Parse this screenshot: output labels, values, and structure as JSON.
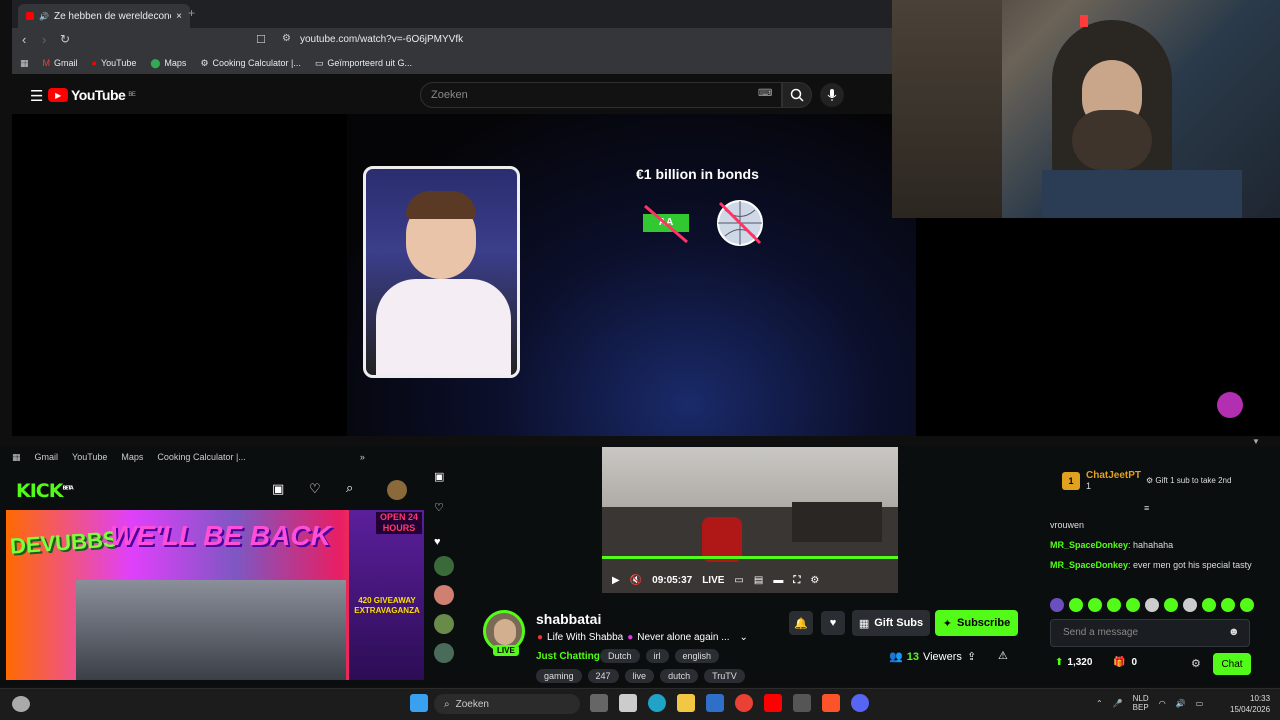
{
  "browser": {
    "tab_title": "Ze hebben de wereldeconom",
    "url": "youtube.com/watch?v=-6O6jPMYVfk",
    "bookmarks": [
      "Gmail",
      "YouTube",
      "Maps",
      "Cooking Calculator |...",
      "Geïmporteerd uit G..."
    ],
    "new_tab": "+",
    "close": "×"
  },
  "youtube": {
    "logo": "YouTube",
    "logo_region": "BE",
    "search_placeholder": "Zoeken"
  },
  "video": {
    "headline": "€1 billion in bonds",
    "badge": "AA"
  },
  "kick_browser": {
    "bookmarks": [
      "Gmail",
      "YouTube",
      "Maps",
      "Cooking Calculator |..."
    ],
    "more": "»"
  },
  "kick": {
    "logo": "KICK",
    "logo_sup": "BETA",
    "thumb_text_1": "WE'LL BE BACK",
    "thumb_text_2": "DEVUBBS",
    "thumb_text_3": "OPEN 24 HOURS",
    "thumb_text_4": "420 GIVEAWAY EXTRAVAGANZA",
    "player_time": "09:05:37",
    "player_live": "LIVE",
    "channel_name": "shabbatai",
    "live_badge": "LIVE",
    "stream_title": "Life With Shabba",
    "stream_title_2": "Never alone again ...",
    "category": "Just Chatting",
    "tags_row1": [
      "Dutch",
      "irl",
      "english"
    ],
    "tags_row2": [
      "gaming",
      "247",
      "live",
      "dutch",
      "TruTV"
    ],
    "gift_subs": "Gift Subs",
    "subscribe": "Subscribe",
    "viewers_count": "13",
    "viewers_label": "Viewers"
  },
  "chat": {
    "pinned_user": "ChatJeetPT",
    "pinned_count": "1",
    "pinned_rank": "1",
    "gift_prompt": "Gift 1 sub to take 2nd",
    "messages": [
      {
        "user": "",
        "text": "vrouwen"
      },
      {
        "user": "MR_SpaceDonkey",
        "text": "hahahaha"
      },
      {
        "user": "MR_SpaceDonkey",
        "text": "ever men got his special tasty"
      }
    ],
    "send_placeholder": "Send a message",
    "points": "1,320",
    "gifts": "0",
    "chat_button": "Chat"
  },
  "taskbar": {
    "search": "Zoeken",
    "lang_1": "NLD",
    "lang_2": "BEP",
    "time": "10:33",
    "date": "15/04/2026"
  },
  "colors": {
    "kick_green": "#53fc18",
    "yt_red": "#ff0000",
    "bg": "#0f0f0f"
  }
}
